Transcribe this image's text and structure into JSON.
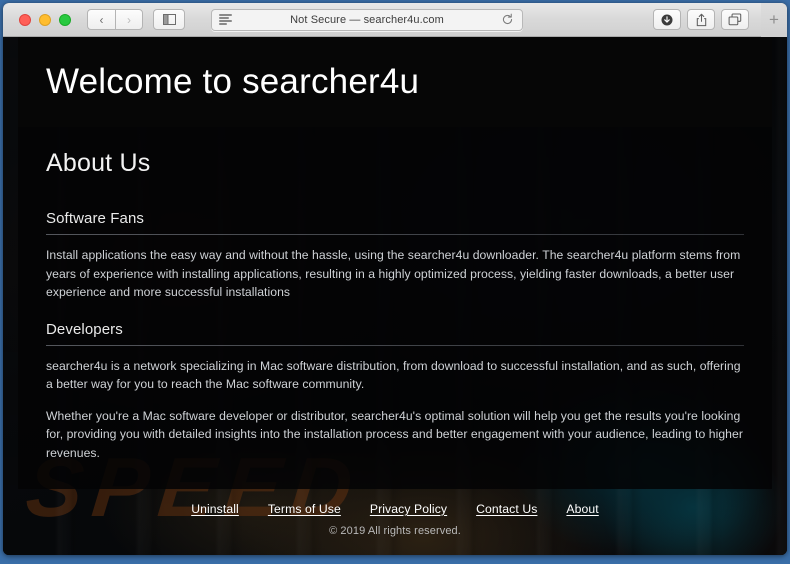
{
  "browser": {
    "traffic_lights": [
      {
        "name": "close",
        "color": "#ff5f57"
      },
      {
        "name": "minimize",
        "color": "#ffbd2e"
      },
      {
        "name": "zoom",
        "color": "#28c940"
      }
    ],
    "back_label": "‹",
    "forward_label": "›",
    "sidebar_label": "◫",
    "address": {
      "text": "Not Secure — searcher4u.com",
      "security_label": "Not Secure",
      "domain": "searcher4u.com",
      "reader_icon": "reader-view-icon",
      "reload_icon": "reload-icon"
    },
    "right_buttons": [
      {
        "name": "downloads-button",
        "icon": "download-icon"
      },
      {
        "name": "share-button",
        "icon": "share-icon"
      },
      {
        "name": "tab-overview-button",
        "icon": "tab-overview-icon"
      }
    ],
    "new_tab_label": "+"
  },
  "page": {
    "hero": {
      "title": "Welcome to searcher4u"
    },
    "about": {
      "heading": "About Us",
      "sections": [
        {
          "title": "Software Fans",
          "paragraphs": [
            "Install applications the easy way and without the hassle, using the searcher4u downloader. The searcher4u platform stems from years of experience with installing applications, resulting in a highly optimized process, yielding faster downloads, a better user experience and more successful installations"
          ]
        },
        {
          "title": "Developers",
          "paragraphs": [
            "searcher4u is a network specializing in Mac software distribution, from download to successful installation, and as such, offering a better way for you to reach the Mac software community.",
            "Whether you're a Mac software developer or distributor, searcher4u's optimal solution will help you get the results you're looking for, providing you with detailed insights into the installation process and better engagement with your audience, leading to higher revenues."
          ]
        }
      ]
    },
    "footer": {
      "links": [
        {
          "label": "Uninstall"
        },
        {
          "label": "Terms of Use"
        },
        {
          "label": "Privacy Policy"
        },
        {
          "label": "Contact Us"
        },
        {
          "label": "About"
        }
      ],
      "copyright": "© 2019 All rights reserved."
    },
    "background": {
      "watermark_text": "SPEED",
      "accent_orange": "#c6601c",
      "water_teal": "#0c687c"
    }
  }
}
